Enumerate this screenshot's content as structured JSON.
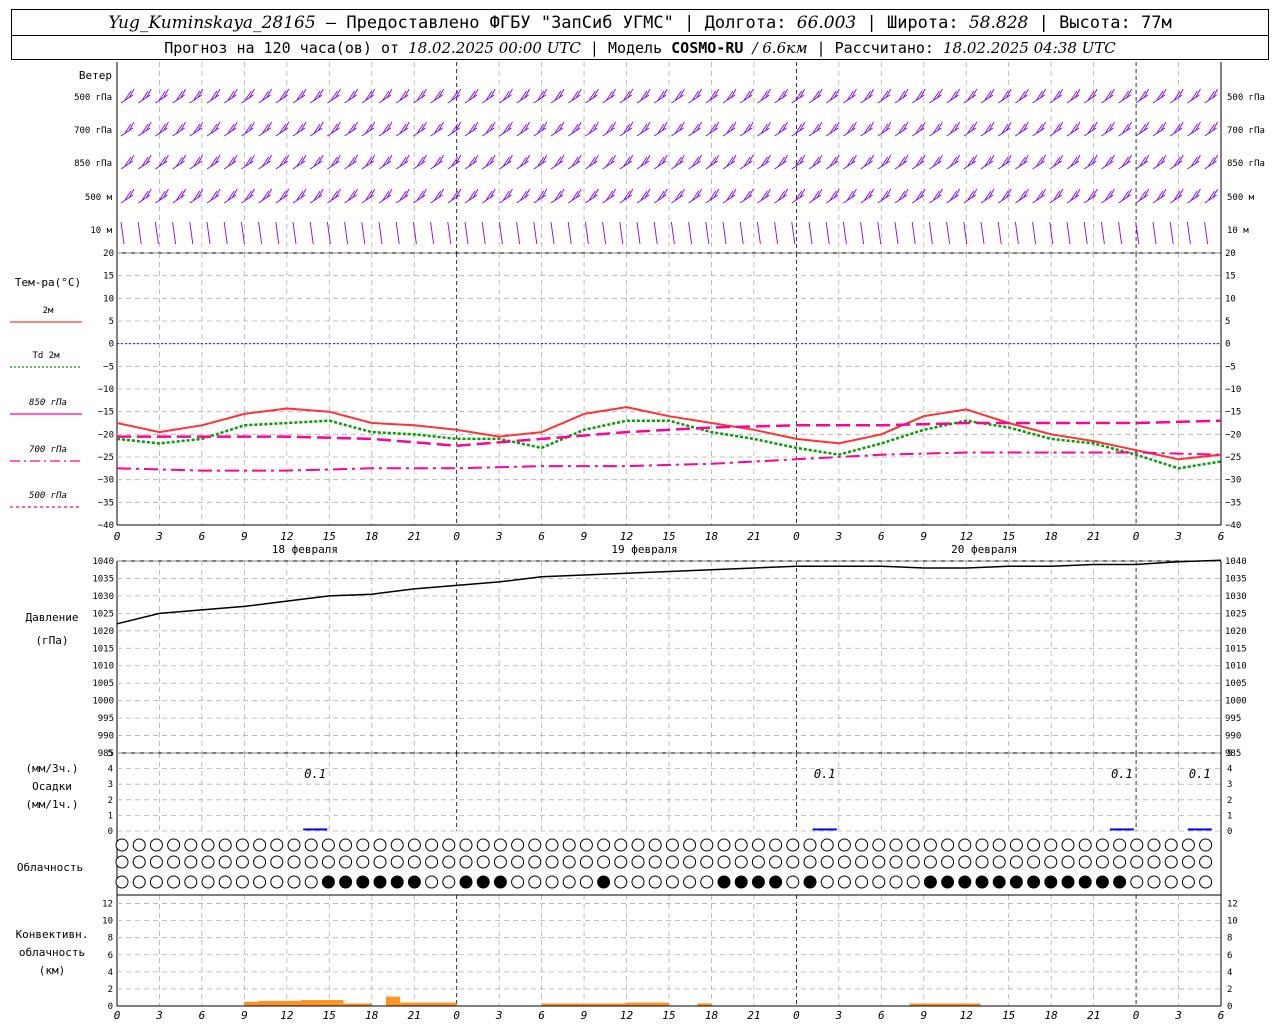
{
  "header": {
    "station": "Yug_Kuminskaya_28165",
    "dash": " – ",
    "provider": "Предоставлено ФГБУ \"ЗапСиб УГМС\"",
    "lon_label": "Долгота:",
    "lon_value": "66.003",
    "lat_label": "Широта:",
    "lat_value": "58.828",
    "alt_label": "Высота:",
    "alt_value": "77м",
    "forecast_prefix": "Прогноз на 120 часа(ов) от",
    "forecast_from": "18.02.2025 00:00 UTC",
    "model_label": "Модель",
    "model_name": "COSMO-RU",
    "model_res": "/ 6.6км",
    "calc_label": "Рассчитано:",
    "calc_value": "18.02.2025 04:38 UTC"
  },
  "chart_data": {
    "type": "meteogram",
    "hours_step": 3,
    "x_ticks": [
      "0",
      "3",
      "6",
      "9",
      "12",
      "15",
      "18",
      "21",
      "0",
      "3",
      "6",
      "9",
      "12",
      "15",
      "18",
      "21",
      "0",
      "3",
      "6",
      "9",
      "12",
      "15",
      "18",
      "21",
      "0",
      "3",
      "6"
    ],
    "date_labels": [
      "18 февраля",
      "19 февраля",
      "20 февраля"
    ],
    "colors": {
      "red": "#ff3333",
      "green": "#00a000",
      "magenta": "#ff0099",
      "wind": "#8000ff",
      "blue": "#0000ff",
      "orange": "#ff8000",
      "grid": "#b0b0b0"
    },
    "wind": {
      "title": "Ветер",
      "levels": [
        "500 гПа",
        "700 гПа",
        "850 гПа",
        "500 м",
        "10  м"
      ]
    },
    "temperature": {
      "title": "Тем-ра(°C)",
      "ylim": [
        -40,
        20
      ],
      "yticks": [
        20,
        15,
        10,
        5,
        0,
        -5,
        -10,
        -15,
        -20,
        -25,
        -30,
        -35,
        -40
      ],
      "legend": [
        {
          "label": "2м",
          "color": "#ff3333"
        },
        {
          "label": "Td  2м",
          "color": "#00a000"
        },
        {
          "label": "850 гПа",
          "color": "#ff0099"
        },
        {
          "label": "700 гПа",
          "color": "#ff0099"
        },
        {
          "label": "500 гПа",
          "color": "#ff0099"
        }
      ],
      "series": [
        {
          "name": "2м",
          "x": [
            0,
            3,
            6,
            9,
            12,
            15,
            18,
            21,
            24,
            27,
            30,
            33,
            36,
            39,
            42,
            45,
            48,
            51,
            54,
            57,
            60,
            63,
            66,
            69,
            72,
            75,
            78
          ],
          "values": [
            -17.5,
            -19.5,
            -18,
            -15.5,
            -14.3,
            -15,
            -17.5,
            -18,
            -19,
            -20.5,
            -19.5,
            -15.5,
            -14,
            -16,
            -17.5,
            -19,
            -21,
            -22,
            -20,
            -16,
            -14.5,
            -17.5,
            -20,
            -21.5,
            -23.5,
            -25.5,
            -24.5
          ]
        },
        {
          "name": "Td 2м",
          "x": [
            0,
            3,
            6,
            9,
            12,
            15,
            18,
            21,
            24,
            27,
            30,
            33,
            36,
            39,
            42,
            45,
            48,
            51,
            54,
            57,
            60,
            63,
            66,
            69,
            72,
            75,
            78
          ],
          "values": [
            -21,
            -22,
            -21,
            -18,
            -17.5,
            -17,
            -19.5,
            -20,
            -21,
            -21,
            -23,
            -19,
            -17,
            -17,
            -19.5,
            -21,
            -23,
            -24.5,
            -22,
            -19,
            -17,
            -18.5,
            -21,
            -22,
            -24.5,
            -27.5,
            -26
          ]
        },
        {
          "name": "850 гПа",
          "x": [
            0,
            6,
            12,
            18,
            24,
            30,
            36,
            42,
            48,
            54,
            60,
            66,
            72,
            78
          ],
          "values": [
            -20.5,
            -20.5,
            -20.5,
            -21,
            -22.5,
            -21,
            -19.5,
            -18.5,
            -18,
            -18,
            -17.5,
            -17.5,
            -17.5,
            -17
          ]
        },
        {
          "name": "700 гПа",
          "x": [
            0,
            6,
            12,
            18,
            24,
            30,
            36,
            42,
            48,
            54,
            60,
            66,
            72,
            78
          ],
          "values": [
            -27.5,
            -28,
            -28,
            -27.5,
            -27.5,
            -27,
            -27,
            -26.5,
            -25.5,
            -24.5,
            -24,
            -24,
            -24,
            -24.5
          ]
        }
      ]
    },
    "pressure": {
      "title": "Давление",
      "unit": "(гПа)",
      "ylim": [
        985,
        1040
      ],
      "yticks": [
        1040,
        1035,
        1030,
        1025,
        1020,
        1015,
        1010,
        1005,
        1000,
        995,
        990,
        985
      ],
      "x": [
        0,
        3,
        6,
        9,
        12,
        15,
        18,
        21,
        24,
        27,
        30,
        33,
        36,
        39,
        42,
        45,
        48,
        51,
        54,
        57,
        60,
        63,
        66,
        69,
        72,
        75,
        78
      ],
      "values": [
        1022,
        1025,
        1026,
        1027,
        1028.5,
        1030,
        1030.5,
        1032,
        1033,
        1034,
        1035.5,
        1036,
        1036.5,
        1037,
        1037.5,
        1038,
        1038.5,
        1038.5,
        1038.5,
        1038,
        1038,
        1038.5,
        1038.5,
        1039,
        1039,
        1039.8,
        1040.2
      ]
    },
    "precip": {
      "title": "Осадки",
      "unit3": "(мм/3ч.)",
      "unit1": "(мм/1ч.)",
      "ylim": [
        0,
        5
      ],
      "yticks": [
        5,
        4,
        3,
        2,
        1,
        0
      ],
      "x": [
        14,
        50,
        71,
        76.5
      ],
      "values": [
        0.1,
        0.1,
        0.1,
        0.1
      ],
      "labels": [
        "0.1",
        "0.1",
        "0.1",
        "0.1"
      ]
    },
    "cloud_title": "Облачность",
    "convective": {
      "title_lines": [
        "Конвективн.",
        "облачность",
        "(км)"
      ],
      "ylim": [
        0,
        13
      ],
      "yticks": [
        12,
        10,
        8,
        6,
        4,
        2,
        0
      ]
    }
  }
}
